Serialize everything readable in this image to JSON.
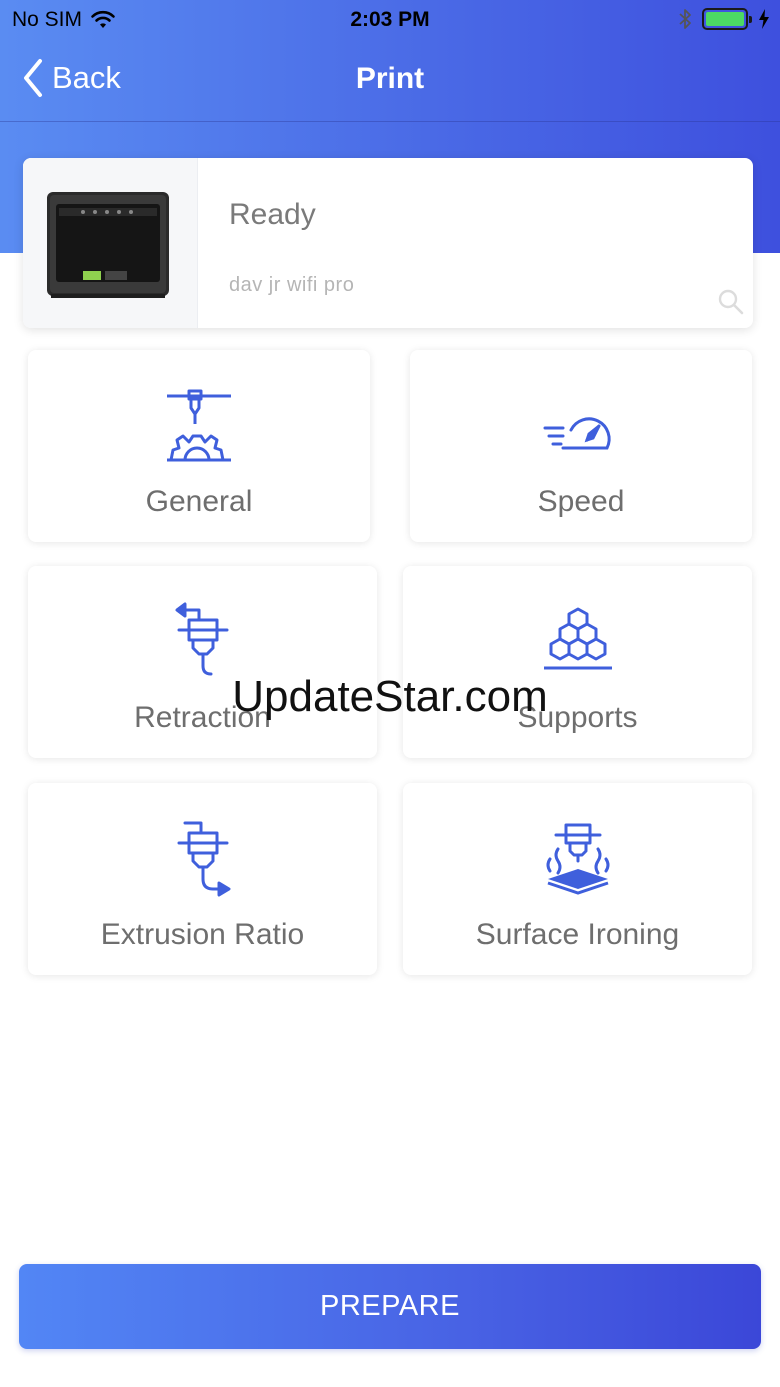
{
  "status_bar": {
    "carrier": "No SIM",
    "time": "2:03 PM",
    "wifi_icon": "wifi-icon",
    "bluetooth_icon": "bluetooth-icon",
    "battery_icon": "battery-icon",
    "battery_level": 1.0,
    "charging_icon": "charging-bolt-icon"
  },
  "nav": {
    "back_label": "Back",
    "title": "Print"
  },
  "printer": {
    "status": "Ready",
    "name": "dav jr wifi pro"
  },
  "tiles": [
    {
      "label": "General",
      "icon": "nozzle-gear-icon"
    },
    {
      "label": "Speed",
      "icon": "speedometer-icon"
    },
    {
      "label": "Retraction",
      "icon": "retraction-icon"
    },
    {
      "label": "Supports",
      "icon": "honeycomb-supports-icon"
    },
    {
      "label": "Extrusion Ratio",
      "icon": "extrusion-ratio-icon"
    },
    {
      "label": "Surface Ironing",
      "icon": "surface-ironing-icon"
    }
  ],
  "watermark": "UpdateStar.com",
  "prepare_label": "PREPARE",
  "colors": {
    "accent": "#4a6ae6",
    "icon_blue": "#3f5fdc",
    "battery_green": "#4cd964"
  }
}
